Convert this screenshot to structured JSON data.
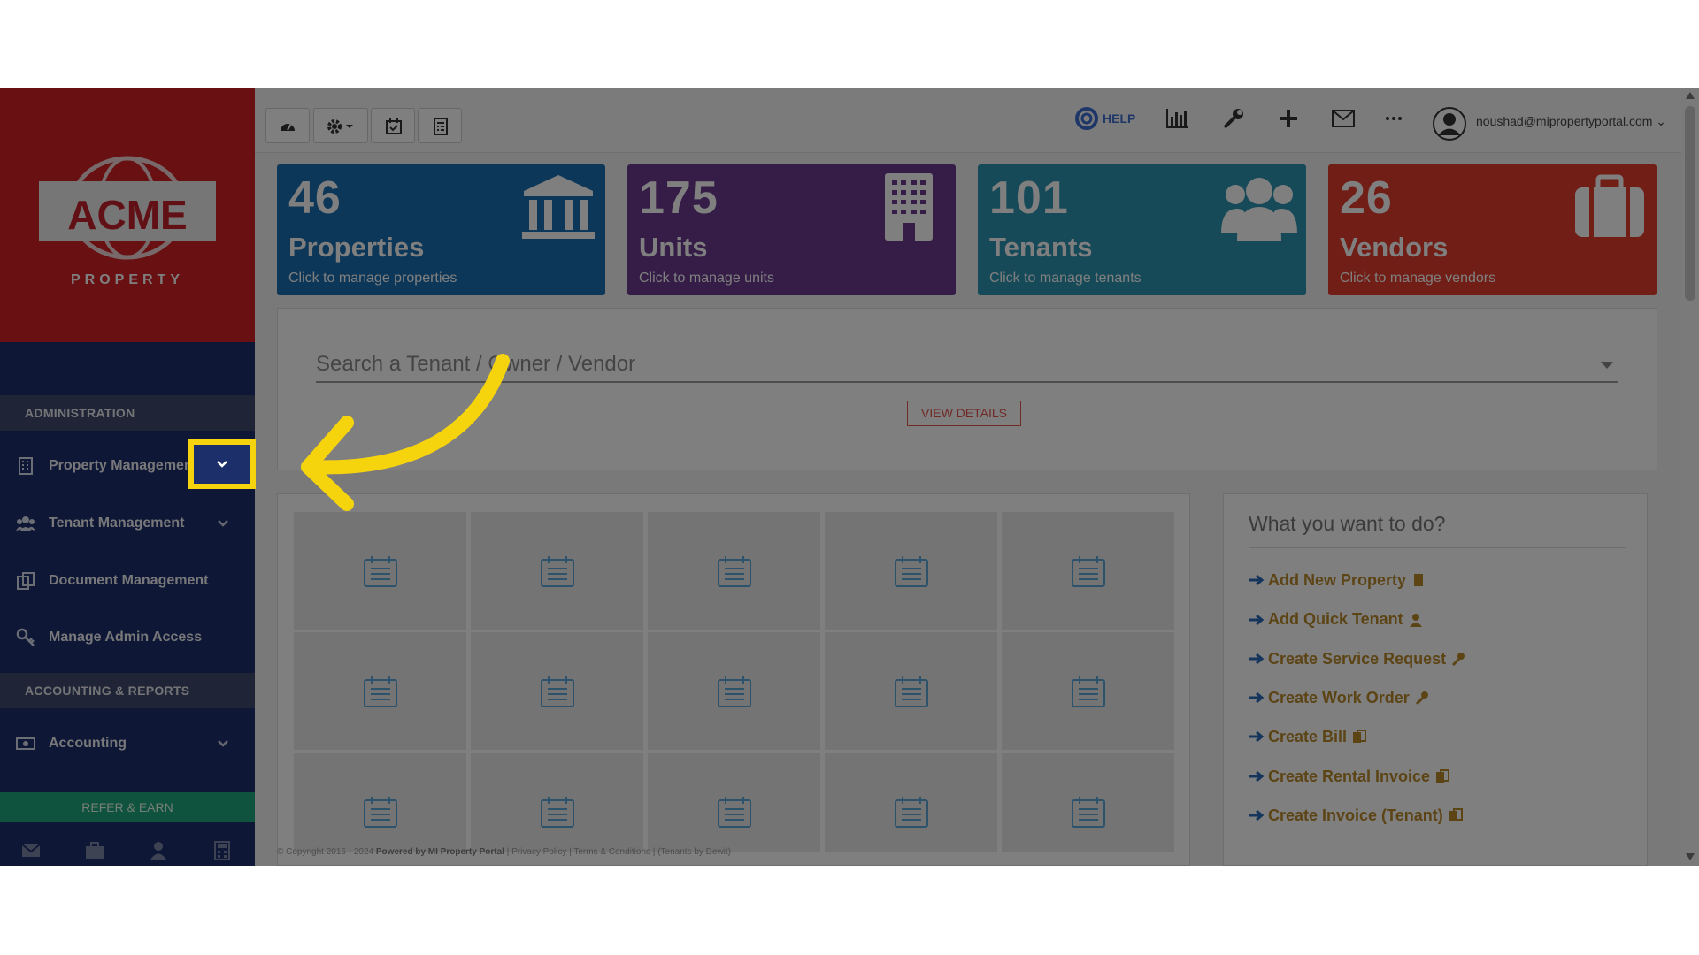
{
  "sidebar": {
    "logo_text": "ACME",
    "logo_subtext": "PROPERTY",
    "sections": [
      {
        "label": "ADMINISTRATION"
      },
      {
        "label": "ACCOUNTING & REPORTS"
      }
    ],
    "items": [
      {
        "label": "Property Management"
      },
      {
        "label": "Tenant Management"
      },
      {
        "label": "Document Management"
      },
      {
        "label": "Manage Admin Access"
      },
      {
        "label": "Accounting"
      }
    ],
    "refer_label": "REFER & EARN"
  },
  "topbar": {
    "help_label": "HELP",
    "user_email": "noushad@mipropertyportal.com"
  },
  "cards": [
    {
      "number": "46",
      "title": "Properties",
      "subtitle": "Click to manage properties",
      "color": "#1b6fb0"
    },
    {
      "number": "175",
      "title": "Units",
      "subtitle": "Click to manage units",
      "color": "#6a3a8f"
    },
    {
      "number": "101",
      "title": "Tenants",
      "subtitle": "Click to manage tenants",
      "color": "#2f95b0"
    },
    {
      "number": "26",
      "title": "Vendors",
      "subtitle": "Click to manage vendors",
      "color": "#e23d2e"
    }
  ],
  "search": {
    "placeholder": "Search a Tenant / Owner / Vendor",
    "view_details_label": "VIEW DETAILS"
  },
  "actions": {
    "title": "What you want to do?",
    "items": [
      {
        "label": "Add New Property"
      },
      {
        "label": "Add Quick Tenant"
      },
      {
        "label": "Create Service Request"
      },
      {
        "label": "Create Work Order"
      },
      {
        "label": "Create Bill"
      },
      {
        "label": "Create Rental Invoice"
      },
      {
        "label": "Create Invoice (Tenant)"
      }
    ]
  },
  "footer": {
    "copyright": "© Copyright 2016 - 2024",
    "powered": "Powered by MI Property Portal",
    "privacy": "Privacy Policy",
    "terms": "Terms & Conditions",
    "tenants_by": "(Tenants by Dewit)"
  },
  "colors": {
    "sidebar_bg": "#1c2f6a",
    "logo_bg": "#d22127",
    "highlight": "#f5d40e",
    "annotation_arrow": "#f5d40e",
    "refer_bg": "#1fa57a"
  }
}
